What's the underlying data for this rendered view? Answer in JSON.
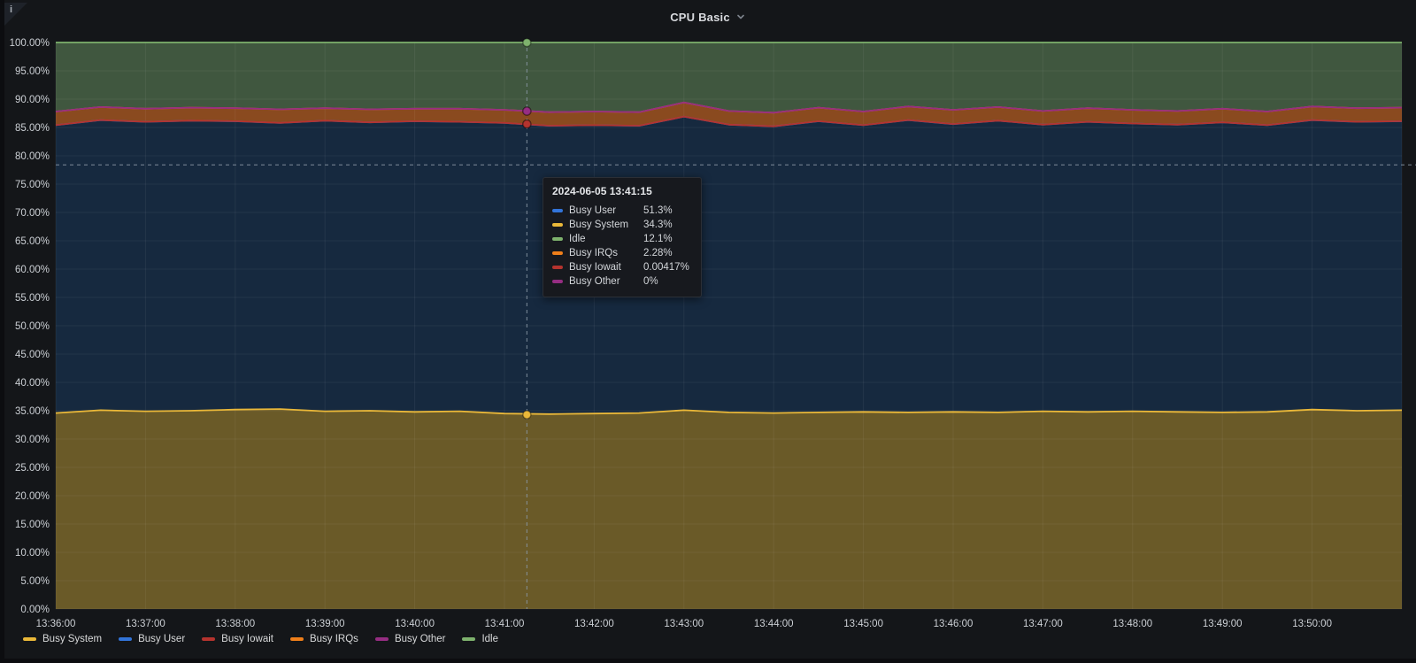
{
  "panel": {
    "title": "CPU Basic",
    "info_icon": "i"
  },
  "chart_data": {
    "type": "area",
    "stacked": true,
    "unit": "percent",
    "ylim": [
      0,
      100
    ],
    "y_tick_labels": [
      "100.00%",
      "95.00%",
      "90.00%",
      "85.00%",
      "80.00%",
      "75.00%",
      "70.00%",
      "65.00%",
      "60.00%",
      "55.00%",
      "50.00%",
      "45.00%",
      "40.00%",
      "35.00%",
      "30.00%",
      "25.00%",
      "20.00%",
      "15.00%",
      "10.00%",
      "5.00%",
      "0.00%"
    ],
    "x_tick_labels": [
      "13:36:00",
      "13:37:00",
      "13:38:00",
      "13:39:00",
      "13:40:00",
      "13:41:00",
      "13:42:00",
      "13:43:00",
      "13:44:00",
      "13:45:00",
      "13:46:00",
      "13:47:00",
      "13:48:00",
      "13:49:00",
      "13:50:00"
    ],
    "x_range_minutes": 15,
    "x_sample_step_seconds": 30,
    "series": [
      {
        "name": "Busy System",
        "color": "#EAB839",
        "fill": "#6a5a28",
        "values": [
          34.6,
          35.1,
          34.9,
          35.0,
          35.2,
          35.3,
          34.9,
          35.0,
          34.8,
          34.9,
          34.5,
          34.4,
          34.5,
          34.6,
          35.1,
          34.7,
          34.6,
          34.7,
          34.8,
          34.7,
          34.8,
          34.7,
          34.9,
          34.8,
          34.9,
          34.8,
          34.7,
          34.8,
          35.2,
          35.0,
          35.1
        ]
      },
      {
        "name": "Busy User",
        "color": "#3274D9",
        "fill": "#16293f",
        "values": [
          50.8,
          51.2,
          51.1,
          51.2,
          50.9,
          50.5,
          51.3,
          50.9,
          51.3,
          51.1,
          51.3,
          50.9,
          50.9,
          50.7,
          51.8,
          50.8,
          50.6,
          51.4,
          50.6,
          51.6,
          50.8,
          51.5,
          50.6,
          51.2,
          50.8,
          50.7,
          51.2,
          50.6,
          51.1,
          51.0,
          51.0
        ]
      },
      {
        "name": "Busy Iowait",
        "color": "#B5332E",
        "fill": null,
        "values": 0.005
      },
      {
        "name": "Busy IRQs",
        "color": "#EF7F1A",
        "fill": "#8a4a1f",
        "values": [
          2.4,
          2.3,
          2.3,
          2.3,
          2.3,
          2.4,
          2.2,
          2.3,
          2.2,
          2.3,
          2.3,
          2.4,
          2.4,
          2.4,
          2.5,
          2.4,
          2.4,
          2.4,
          2.4,
          2.4,
          2.5,
          2.4,
          2.4,
          2.4,
          2.4,
          2.4,
          2.4,
          2.4,
          2.4,
          2.4,
          2.4
        ]
      },
      {
        "name": "Busy Other",
        "color": "#962D82",
        "fill": null,
        "values": 0
      },
      {
        "name": "Idle",
        "color": "#7EB26D",
        "fill": "#40573f",
        "values": [
          12.2,
          11.4,
          11.7,
          11.5,
          11.6,
          11.8,
          11.6,
          11.8,
          11.7,
          11.7,
          11.9,
          12.3,
          12.2,
          12.3,
          10.6,
          12.1,
          12.4,
          11.5,
          12.2,
          11.3,
          11.9,
          11.4,
          12.1,
          11.6,
          11.9,
          12.1,
          11.7,
          12.2,
          11.3,
          11.6,
          11.5
        ]
      }
    ]
  },
  "crosshair": {
    "time_label": "13:41:15",
    "time_offset_minutes": 5.25,
    "hover_percent": 78.4
  },
  "tooltip": {
    "timestamp": "2024-06-05 13:41:15",
    "rows": [
      {
        "name": "Busy User",
        "color": "#3274D9",
        "value": "51.3%",
        "num": 51.3
      },
      {
        "name": "Busy System",
        "color": "#EAB839",
        "value": "34.3%",
        "num": 34.3
      },
      {
        "name": "Idle",
        "color": "#7EB26D",
        "value": "12.1%",
        "num": 12.1
      },
      {
        "name": "Busy IRQs",
        "color": "#EF7F1A",
        "value": "2.28%",
        "num": 2.28
      },
      {
        "name": "Busy Iowait",
        "color": "#B5332E",
        "value": "0.00417%",
        "num": 0.00417
      },
      {
        "name": "Busy Other",
        "color": "#962D82",
        "value": "0%",
        "num": 0
      }
    ]
  },
  "legend": {
    "items": [
      {
        "label": "Busy System",
        "color": "#EAB839"
      },
      {
        "label": "Busy User",
        "color": "#3274D9"
      },
      {
        "label": "Busy Iowait",
        "color": "#B5332E"
      },
      {
        "label": "Busy IRQs",
        "color": "#EF7F1A"
      },
      {
        "label": "Busy Other",
        "color": "#962D82"
      },
      {
        "label": "Idle",
        "color": "#7EB26D"
      }
    ]
  },
  "colors": {
    "panel_bg": "#141619",
    "grid": "rgba(255,255,255,0.06)",
    "axis_text": "#ccd0d5",
    "crosshair": "#8a97a5"
  }
}
